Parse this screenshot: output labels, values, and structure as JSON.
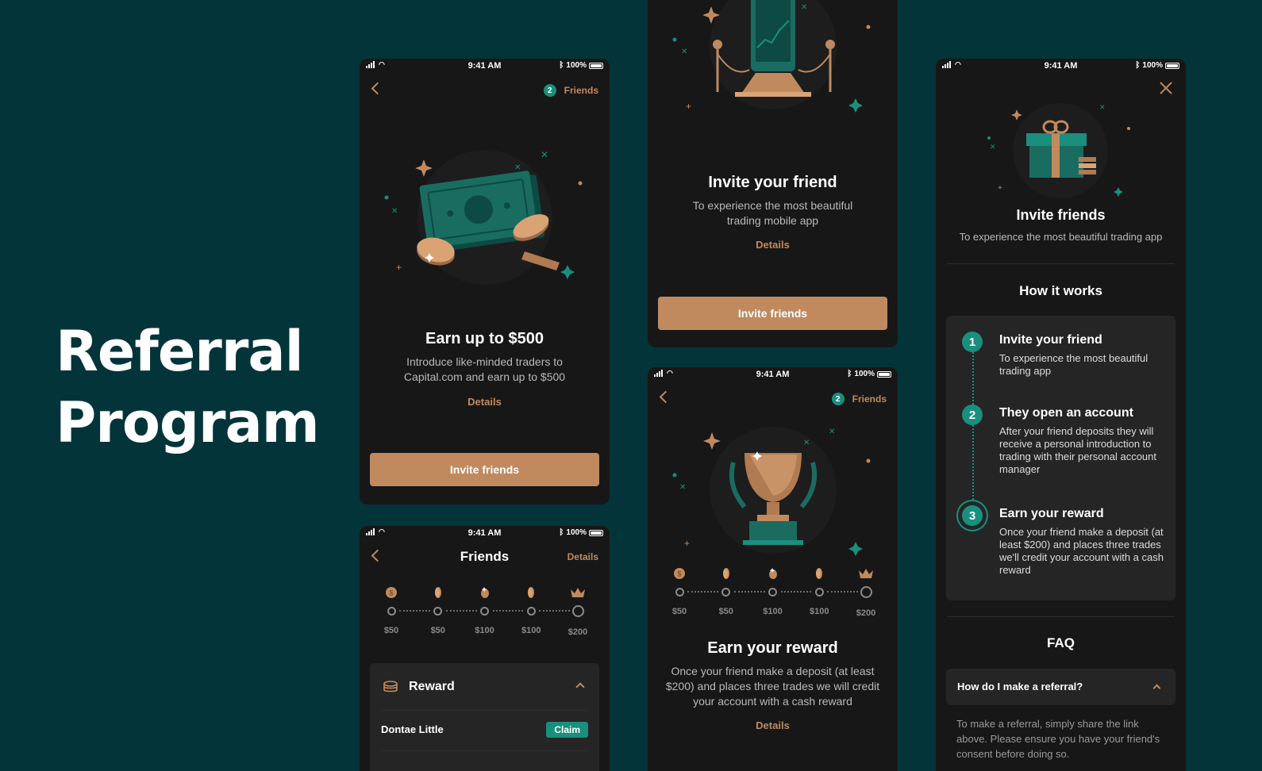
{
  "headline": {
    "line1": "Referral",
    "line2": "Program"
  },
  "status": {
    "time": "9:41 AM",
    "battery": "100%"
  },
  "screen_earn": {
    "friends_count": "2",
    "friends_label": "Friends",
    "title": "Earn up to $500",
    "subtitle": "Introduce like-minded traders to Capital.com and earn up to $500",
    "details": "Details",
    "button": "Invite friends"
  },
  "screen_invite": {
    "title": "Invite your friend",
    "subtitle": "To experience the most beautiful trading mobile app",
    "details": "Details",
    "button": "Invite friends"
  },
  "screen_friends": {
    "title": "Friends",
    "details": "Details",
    "reward_title": "Reward",
    "row_name": "Dontae Little",
    "row_action": "Claim"
  },
  "screen_reward": {
    "friends_count": "2",
    "friends_label": "Friends",
    "title": "Earn your reward",
    "subtitle": "Once your friend make a deposit (at least $200) and places three trades we will credit your account with a cash reward",
    "details": "Details"
  },
  "milestones": [
    "$50",
    "$50",
    "$100",
    "$100",
    "$200"
  ],
  "milestone_icons": [
    "coin-icon",
    "coin-edge-icon",
    "coin-bag-icon",
    "coin-edge-icon",
    "crown-icon"
  ],
  "screen_how": {
    "title": "Invite friends",
    "subtitle": "To experience the most beautiful trading app",
    "how_title": "How it works",
    "steps": [
      {
        "num": "1",
        "title": "Invite your friend",
        "desc": "To experience the most beautiful trading app"
      },
      {
        "num": "2",
        "title": "They open an account",
        "desc": "After your friend deposits they will receive a personal introduction to trading with their personal account manager"
      },
      {
        "num": "3",
        "title": "Earn your reward",
        "desc": "Once your friend make a deposit (at least $200) and places three trades we'll credit your account with a cash reward"
      }
    ],
    "faq_title": "FAQ",
    "faq_question": "How do I make a referral?",
    "faq_answer": "To make a referral, simply share the link above. Please ensure you have your friend's consent before doing so."
  },
  "colors": {
    "background": "#03343a",
    "panel": "#171717",
    "accent": "#c08a5e",
    "teal": "#1a8f7e"
  }
}
